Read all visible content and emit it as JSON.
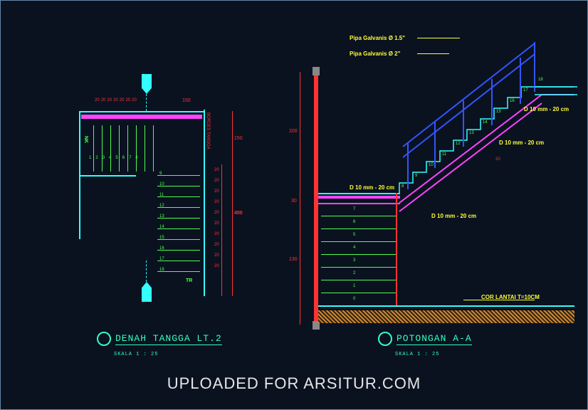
{
  "watermark": "UPLOADED FOR ARSITUR.COM",
  "titles": {
    "plan": {
      "main": "DENAH TANGGA LT.2",
      "sub": "SKALA 1 : 25"
    },
    "section": {
      "main": "POTONGAN A-A",
      "sub": "SKALA 1 : 25"
    }
  },
  "plan": {
    "label_nk": "NK",
    "label_tr": "TR",
    "label_bordes": "BORDES TANGGA",
    "dims_top": [
      "20",
      "20",
      "20",
      "20",
      "20",
      "20",
      "20"
    ],
    "dim_150a": "150",
    "dim_150b": "150",
    "dim_400": "400",
    "dim_20s": [
      "20",
      "20",
      "20",
      "20",
      "20",
      "20",
      "20",
      "20",
      "20",
      "20"
    ],
    "steps_left": [
      "1",
      "2",
      "3",
      "4",
      "5",
      "6",
      "7",
      "8"
    ],
    "steps_right": [
      "9",
      "10",
      "11",
      "12",
      "13",
      "14",
      "15",
      "16",
      "17",
      "18"
    ]
  },
  "section": {
    "pipe1": "Pipa Galvanis Ø 1.5\"",
    "pipe2": "Pipa Galvanis Ø 2\"",
    "rebar": "D 10 mm - 20 cm",
    "floor": "COR LANTAI T=10CM",
    "dim_200": "200",
    "dim_30": "30",
    "dim_130": "130",
    "dim_20": "20",
    "steps_lower": [
      "0",
      "1",
      "2",
      "3",
      "4",
      "5",
      "6",
      "7"
    ],
    "steps_upper": [
      "8",
      "9",
      "10",
      "11",
      "12",
      "13",
      "14",
      "15",
      "16",
      "17",
      "18"
    ]
  }
}
